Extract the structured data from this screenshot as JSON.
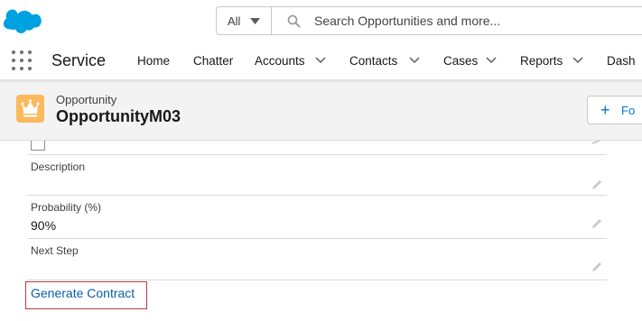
{
  "header": {
    "logo_icon": "salesforce-cloud-icon",
    "search": {
      "scope": "All",
      "placeholder": "Search Opportunities and more..."
    }
  },
  "nav": {
    "app_name": "Service",
    "items": [
      {
        "label": "Home",
        "has_menu": false
      },
      {
        "label": "Chatter",
        "has_menu": false
      },
      {
        "label": "Accounts",
        "has_menu": true
      },
      {
        "label": "Contacts",
        "has_menu": true
      },
      {
        "label": "Cases",
        "has_menu": true
      },
      {
        "label": "Reports",
        "has_menu": true
      },
      {
        "label": "Dash",
        "has_menu": false
      }
    ]
  },
  "record": {
    "type": "Opportunity",
    "name": "OpportunityM03",
    "icon": "crown-icon",
    "follow_label": "Fo",
    "follow_icon": "plus-icon"
  },
  "fields": [
    {
      "label": "Description",
      "value": ""
    },
    {
      "label": "Probability (%)",
      "value": "90%"
    },
    {
      "label": "Next Step",
      "value": ""
    }
  ],
  "actions": {
    "generate_contract": "Generate Contract"
  },
  "colors": {
    "brand_blue": "#0176d3",
    "record_icon_bg": "#fcb95b",
    "highlight_border": "#c23934",
    "link": "#0b5cab"
  }
}
